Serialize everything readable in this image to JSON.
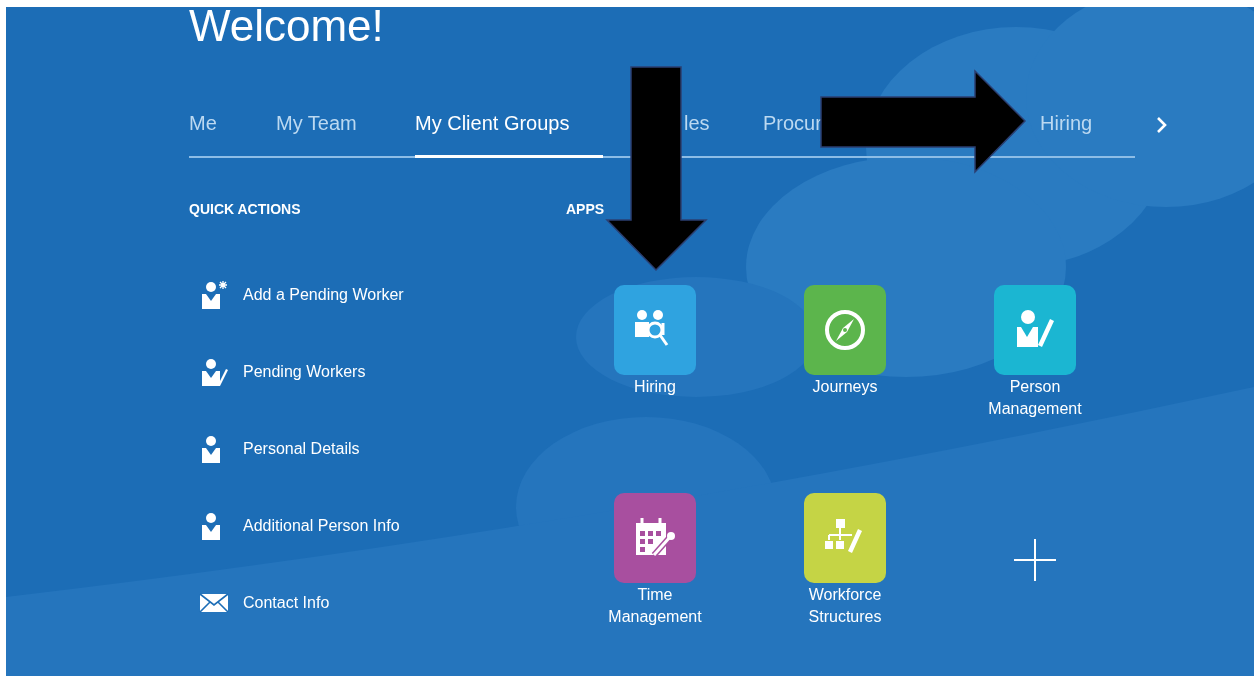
{
  "greeting": "Welcome!",
  "tabs": [
    {
      "label": "Me",
      "selected": false
    },
    {
      "label": "My Team",
      "selected": false
    },
    {
      "label": "My Client Groups",
      "selected": true
    },
    {
      "label": "les",
      "selected": false
    },
    {
      "label": "Procur",
      "selected": false
    },
    {
      "label": "Hiring",
      "selected": false
    }
  ],
  "quick_actions": {
    "title": "QUICK ACTIONS",
    "items": [
      {
        "label": "Add a Pending Worker"
      },
      {
        "label": "Pending Workers"
      },
      {
        "label": "Personal Details"
      },
      {
        "label": "Additional Person Info"
      },
      {
        "label": "Contact Info"
      }
    ]
  },
  "apps": {
    "title": "APPS",
    "items": [
      {
        "label": "Hiring",
        "color": "#2fa3e0"
      },
      {
        "label": "Journeys",
        "color": "#5cb54c"
      },
      {
        "label": "Person Management",
        "color": "#1bb6d2"
      },
      {
        "label": "Time Management",
        "color": "#a84f9f"
      },
      {
        "label": "Workforce Structures",
        "color": "#c5d445"
      }
    ]
  }
}
